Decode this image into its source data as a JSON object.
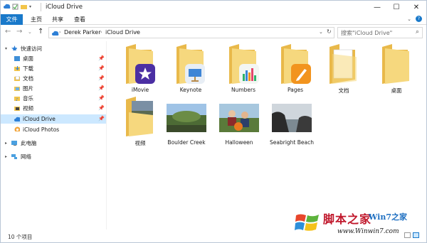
{
  "window": {
    "title": "iCloud Drive"
  },
  "ribbon": {
    "tabs": [
      "文件",
      "主页",
      "共享",
      "查看"
    ]
  },
  "address": {
    "crumbs": [
      "Derek Parker",
      "iCloud Drive"
    ]
  },
  "search": {
    "placeholder": "搜索\"iCloud Drive\""
  },
  "sidebar": {
    "quick_access": "快速访问",
    "items": [
      {
        "label": "桌面",
        "pinned": true,
        "icon": "desktop-folder-icon"
      },
      {
        "label": "下载",
        "pinned": true,
        "icon": "download-folder-icon"
      },
      {
        "label": "文档",
        "pinned": true,
        "icon": "documents-folder-icon"
      },
      {
        "label": "图片",
        "pinned": true,
        "icon": "pictures-folder-icon"
      },
      {
        "label": "音乐",
        "pinned": true,
        "icon": "music-folder-icon"
      },
      {
        "label": "视频",
        "pinned": true,
        "icon": "videos-folder-icon"
      },
      {
        "label": "iCloud Drive",
        "pinned": true,
        "icon": "icloud-icon",
        "selected": true
      },
      {
        "label": "iCloud Photos",
        "pinned": true,
        "icon": "icloud-photos-icon"
      }
    ],
    "this_pc": "此电脑",
    "network": "网络"
  },
  "files": [
    {
      "name": "iMovie",
      "kind": "app-folder",
      "badge": "imovie-icon",
      "badge_color": "#5b3bb3"
    },
    {
      "name": "Keynote",
      "kind": "app-folder",
      "badge": "keynote-icon",
      "badge_color": "#3e85d6"
    },
    {
      "name": "Numbers",
      "kind": "app-folder",
      "badge": "numbers-icon",
      "badge_color": "#2fb36b"
    },
    {
      "name": "Pages",
      "kind": "app-folder",
      "badge": "pages-icon",
      "badge_color": "#f2941e"
    },
    {
      "name": "文档",
      "kind": "doc-folder"
    },
    {
      "name": "桌面",
      "kind": "folder"
    },
    {
      "name": "视频",
      "kind": "photo-folder"
    },
    {
      "name": "Boulder Creek",
      "kind": "photo"
    },
    {
      "name": "Halloween",
      "kind": "photo"
    },
    {
      "name": "Seabright Beach",
      "kind": "photo"
    }
  ],
  "status": {
    "count_text": "10 个项目"
  },
  "watermark": {
    "line1": "脚本之家",
    "line2": "Win7之家",
    "url": "www.Winwin7.com"
  },
  "colors": {
    "accent": "#1979ca",
    "folder": "#f3d27a",
    "selected": "#cce8ff"
  }
}
